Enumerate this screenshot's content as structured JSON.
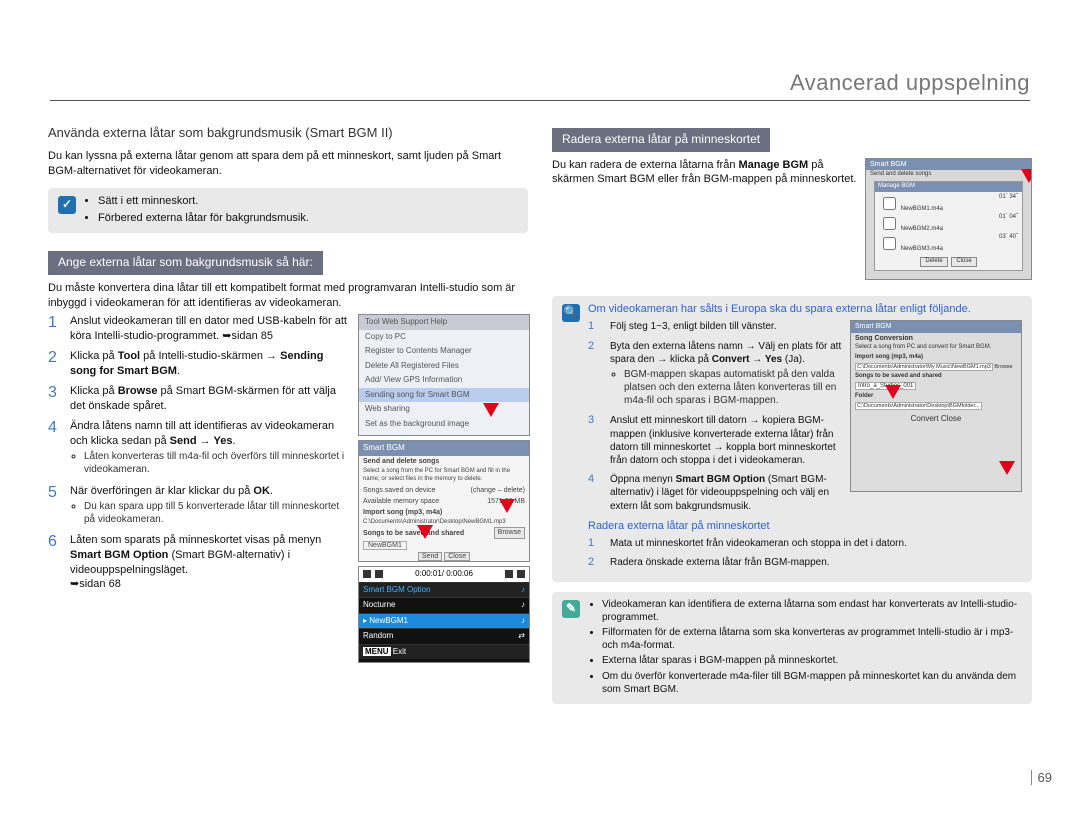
{
  "pageTitle": "Avancerad uppspelning",
  "pageNumber": "69",
  "left": {
    "subhead": "Använda externa låtar som bakgrundsmusik (Smart BGM II)",
    "intro": "Du kan lyssna på externa låtar genom att spara dem på ett minneskort, samt ljuden på Smart BGM-alternativet för videokameran.",
    "prebox_icon": "✓",
    "prebox_items": [
      "Sätt i ett minneskort.",
      "Förbered externa låtar för bakgrundsmusik."
    ],
    "bar": "Ange externa låtar som bakgrundsmusik så här:",
    "para": "Du måste konvertera dina låtar till ett kompatibelt format med programvaran Intelli-studio som är inbyggd i videokameran för att identifieras av videokameran.",
    "step1": "Anslut videokameran till en dator med USB-kabeln för att köra Intelli-studio-programmet. ➥sidan 85",
    "step2_a": "Klicka på ",
    "step2_b": "Tool",
    "step2_c": " på Intelli-studio-skärmen → ",
    "step2_d": "Sending song for Smart BGM",
    "step2_e": ".",
    "step3_a": "Klicka på ",
    "step3_b": "Browse",
    "step3_c": " på Smart BGM-skärmen för att välja det önskade spåret.",
    "step4_a": "Ändra låtens namn till att identifieras av videokameran och klicka sedan på ",
    "step4_b": "Send → Yes",
    "step4_c": ".",
    "step4_bul": [
      "Låten konverteras till m4a-fil och överförs till minneskortet i videokameran."
    ],
    "step5_a": "När överföringen är klar klickar du på ",
    "step5_b": "OK",
    "step5_c": ".",
    "step5_bul": [
      "Du kan spara upp till 5 konverterade låtar till minneskortet på videokameran."
    ],
    "step6_a": "Låten som sparats på minneskortet visas på menyn ",
    "step6_b": "Smart BGM Option",
    "step6_c": " (Smart BGM-alternativ) i videouppspelningsläget.",
    "step6_link": "➥sidan 68",
    "toolmenu_title": "Tool   Web Support   Help",
    "toolmenu_items": [
      "Copy to PC",
      "Register to Contents Manager",
      "Delete All Registered Files",
      "Add/ View GPS Information",
      "Sending song for Smart BGM",
      "Web sharing",
      "Set as the background image"
    ],
    "sb_hd": "Smart BGM",
    "sb_section1": "Send and delete songs",
    "sb_desc": "Select a song from the PC for Smart BGM and fill in the name, or select files in the memory to delete.",
    "sb_r1l": "Songs saved on device",
    "sb_r1r": "(change – delete)",
    "sb_r2l": "Available memory space",
    "sb_r2r": "1571.66 MB",
    "sb_imp": "Import song (mp3, m4a)",
    "sb_path": "C:\\Documents\\Administrator\\Desktop\\NewBGM1.mp3",
    "sb_browse": "Browse",
    "sb_save": "Songs to be saved and shared",
    "sb_name": "NewBGM1",
    "sb_send": "Send",
    "sb_close": "Close",
    "player_time": "0:00:01/ 0:00:06",
    "player_title": "Smart BGM Option",
    "player_items": [
      "Nocturne",
      "NewBGM1",
      "Random"
    ],
    "player_exit": "Exit",
    "player_menu": "MENU"
  },
  "right": {
    "bar": "Radera externa låtar på minneskortet",
    "para_a": "Du kan radera de externa låtarna från ",
    "para_b": "Manage BGM",
    "para_c": " på skärmen Smart BGM eller från BGM-mappen på minneskortet.",
    "mgr_top": "Smart BGM",
    "mgr_sub": "Send and delete songs",
    "mgr_mng": "Manage BGM",
    "mgr_rows": [
      [
        "NewBGM1.m4a",
        "01´ 34˝"
      ],
      [
        "NewBGM2.m4a",
        "01´ 04˝"
      ],
      [
        "NewBGM3.m4a",
        "03´ 40˝"
      ]
    ],
    "mgr_del": "Delete",
    "mgr_close": "Close",
    "box_icon": "🔍",
    "box_lead": "Om videokameran har sålts i Europa ska du spara externa låtar enligt följande.",
    "b1": "Följ steg 1~3, enligt bilden till vänster.",
    "b2_a": "Byta den externa låtens namn → Välj en plats för att spara den → klicka på ",
    "b2_b": "Convert → Yes",
    "b2_c": " (Ja).",
    "b2_bul": [
      "BGM-mappen skapas automatiskt på den valda platsen och den externa låten konverteras till en m4a-fil och sparas i BGM-mappen."
    ],
    "b3": "Anslut ett minneskort till datorn → kopiera BGM-mappen (inklusive konverterade externa låtar) från datorn till minneskortet → koppla bort minneskortet från datorn och stoppa i det i videokameran.",
    "b4_a": "Öppna menyn ",
    "b4_b": "Smart BGM Option",
    "b4_c": " (Smart BGM-alternativ) i läget för videouppspelning och välj en extern låt som bakgrundsmusik.",
    "sub_blue": "Radera externa låtar på minneskortet",
    "s1": "Mata ut minneskortet från videokameran och stoppa in det i datorn.",
    "s2": "Radera önskade externa låtar från BGM-mappen.",
    "midimg_title": "Smart BGM",
    "midimg_sc": "Song Conversion",
    "midimg_desc": "Select a song from PC and convert for Smart BGM.",
    "midimg_import": "Import song (mp3, m4a)",
    "midimg_path1": "C:\\Documents\\Administrator\\My Music\\NewBGM1.mp3",
    "midimg_browse": "Browse",
    "midimg_save": "Songs to be saved and shared",
    "midimg_name": "Intro_a_Studies_001",
    "midimg_folder": "Folder",
    "midimg_path2": "C:\\Documents\\Administrator\\Desktop\\BGMfolder...",
    "midimg_convert": "Convert",
    "midimg_close": "Close",
    "note_icon": "✎",
    "notes": [
      "Videokameran kan identifiera de externa låtarna som endast har konverterats av Intelli-studio-programmet.",
      "Filformaten för de externa låtarna som ska konverteras av programmet Intelli-studio är i mp3- och m4a-format.",
      "Externa låtar sparas i BGM-mappen på minneskortet.",
      "Om du överför konverterade m4a-filer till BGM-mappen på minneskortet kan du använda dem som Smart BGM."
    ]
  }
}
